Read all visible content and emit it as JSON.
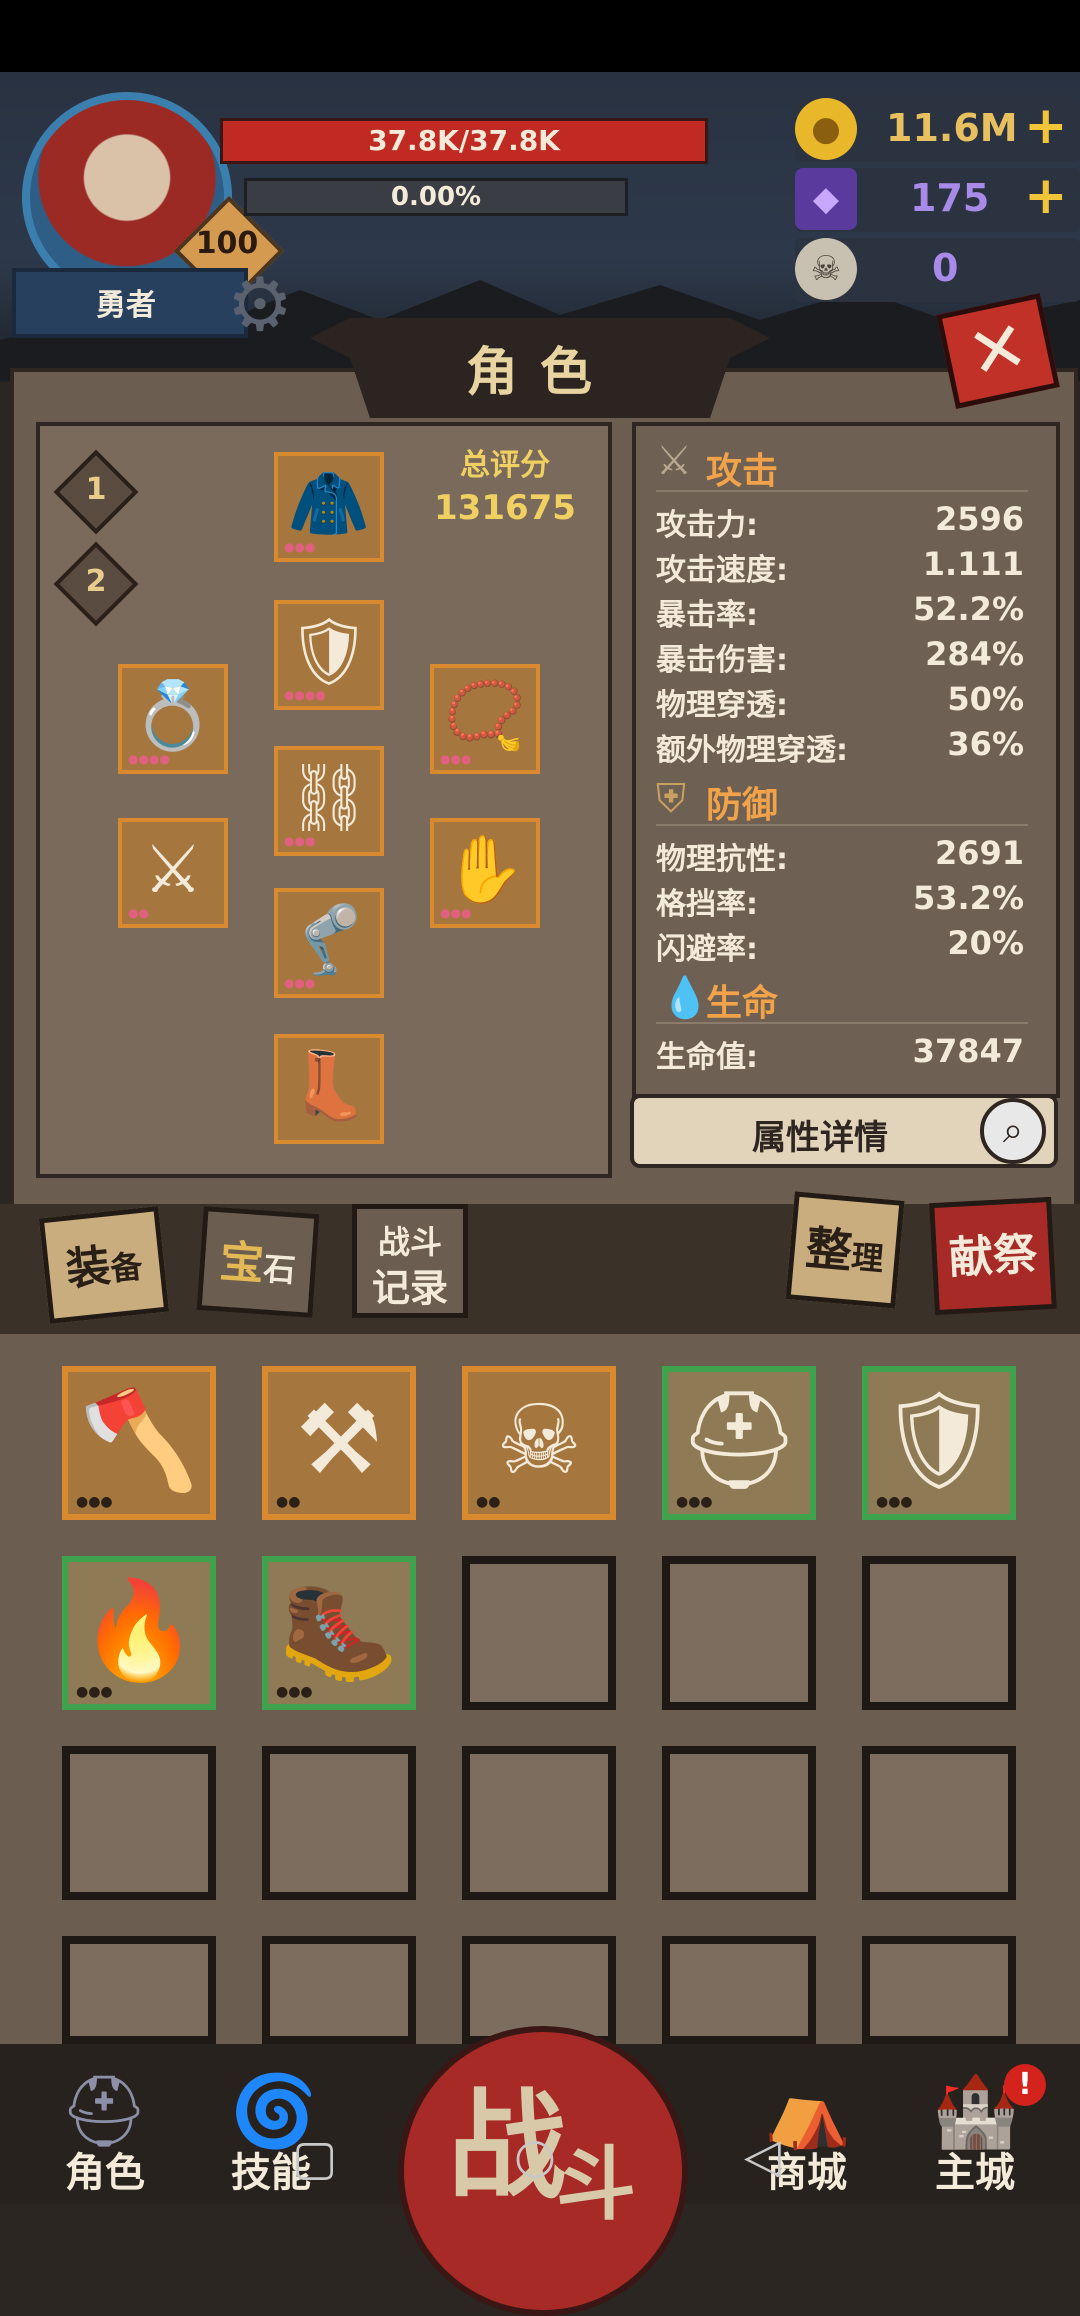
{
  "player": {
    "name": "勇者",
    "level": "100",
    "hp_text": "37.8K/37.8K",
    "hp_fraction": 1.0,
    "xp_text": "0.00%",
    "xp_fraction": 0.0
  },
  "resources": {
    "gold": "11.6M",
    "gem": "175",
    "skull": "0",
    "plus_symbol": "+"
  },
  "panel": {
    "title": "角色",
    "close_symbol": "✕"
  },
  "loadouts": [
    "1",
    "2"
  ],
  "score": {
    "label": "总评分",
    "value": "131675"
  },
  "equipped": {
    "hood": {
      "icon": "hood-icon"
    },
    "chest": {
      "icon": "chest-armor-icon"
    },
    "ring": {
      "icon": "ring-icon"
    },
    "necklace": {
      "icon": "necklace-icon"
    },
    "belt": {
      "icon": "belt-icon"
    },
    "weapon": {
      "icon": "scythe-icon"
    },
    "gloves": {
      "icon": "claw-gloves-icon"
    },
    "greaves": {
      "icon": "greaves-icon"
    },
    "boots": {
      "icon": "boots-icon"
    }
  },
  "stats": {
    "attack": {
      "heading": "攻击",
      "rows": [
        {
          "label": "攻击力:",
          "value": "2596"
        },
        {
          "label": "攻击速度:",
          "value": "1.111"
        },
        {
          "label": "暴击率:",
          "value": "52.2%"
        },
        {
          "label": "暴击伤害:",
          "value": "284%"
        },
        {
          "label": "物理穿透:",
          "value": "50%"
        },
        {
          "label": "额外物理穿透:",
          "value": "36%"
        }
      ]
    },
    "defense": {
      "heading": "防御",
      "rows": [
        {
          "label": "物理抗性:",
          "value": "2691"
        },
        {
          "label": "格挡率:",
          "value": "53.2%"
        },
        {
          "label": "闪避率:",
          "value": "20%"
        }
      ]
    },
    "life": {
      "heading": "生命",
      "rows": [
        {
          "label": "生命值:",
          "value": "37847"
        }
      ]
    },
    "detail_button": "属性详情"
  },
  "tabs": {
    "equip_a": "装",
    "equip_b": "备",
    "gem_a": "宝",
    "gem_b": "石",
    "log_line1": "战斗",
    "log_line2": "记录",
    "sort_a": "整",
    "sort_b": "理",
    "offer": "献祭"
  },
  "inventory": [
    {
      "icon": "battle-axe-icon",
      "rarity": "orange"
    },
    {
      "icon": "rune-axe-icon",
      "rarity": "orange"
    },
    {
      "icon": "ram-skull-shield-icon",
      "rarity": "orange"
    },
    {
      "icon": "crowned-helmet-icon",
      "rarity": "green"
    },
    {
      "icon": "plate-armor-icon",
      "rarity": "green"
    },
    {
      "icon": "fire-belt-icon",
      "rarity": "green"
    },
    {
      "icon": "armored-boots-icon",
      "rarity": "green"
    }
  ],
  "nav": {
    "character": "角色",
    "skills": "技能",
    "fight_a": "战",
    "fight_b": "斗",
    "shop": "商城",
    "town": "主城",
    "alert": "!"
  },
  "colors": {
    "hp": "#c12a22",
    "rarity_orange": "#d98a2e",
    "rarity_green": "#3ea34c",
    "accent_gold": "#f0d060",
    "section_heading": "#f2a34a"
  }
}
